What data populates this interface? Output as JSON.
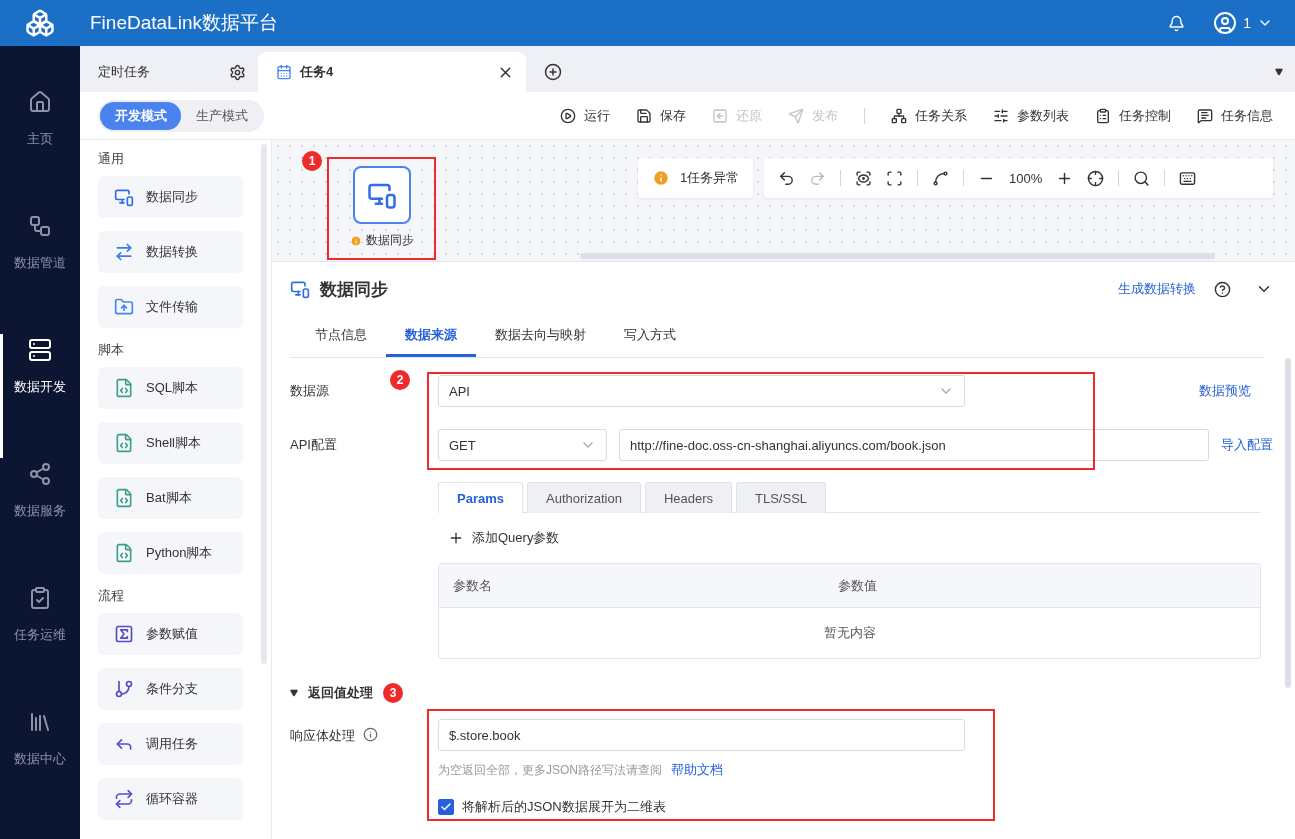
{
  "app": {
    "title": "FineDataLink数据平台",
    "user": "1"
  },
  "nav": [
    {
      "label": "主页",
      "selected": false
    },
    {
      "label": "数据管道",
      "selected": false
    },
    {
      "label": "数据开发",
      "selected": true
    },
    {
      "label": "数据服务",
      "selected": false
    },
    {
      "label": "任务运维",
      "selected": false
    },
    {
      "label": "数据中心",
      "selected": false
    }
  ],
  "tabs": [
    {
      "label": "定时任务",
      "kind": "folder",
      "selected": false
    },
    {
      "label": "任务4",
      "kind": "task",
      "selected": true
    }
  ],
  "modes": [
    {
      "label": "开发模式",
      "selected": true
    },
    {
      "label": "生产模式",
      "selected": false
    }
  ],
  "toolbar": [
    {
      "label": "运行",
      "disabled": false
    },
    {
      "label": "保存",
      "disabled": false
    },
    {
      "label": "还原",
      "disabled": true
    },
    {
      "label": "发布",
      "disabled": true
    },
    {
      "label": "任务关系",
      "disabled": false
    },
    {
      "label": "参数列表",
      "disabled": false
    },
    {
      "label": "任务控制",
      "disabled": false
    },
    {
      "label": "任务信息",
      "disabled": false
    }
  ],
  "palette": [
    {
      "title": "通用",
      "items": [
        "数据同步",
        "数据转换",
        "文件传输"
      ]
    },
    {
      "title": "脚本",
      "items": [
        "SQL脚本",
        "Shell脚本",
        "Bat脚本",
        "Python脚本"
      ]
    },
    {
      "title": "流程",
      "items": [
        "参数赋值",
        "条件分支",
        "调用任务",
        "循环容器"
      ]
    }
  ],
  "canvas": {
    "warning": "1任务异常",
    "zoom": "100%",
    "node": {
      "label": "数据同步",
      "marker": "1",
      "warning": true
    }
  },
  "panel": {
    "title": "数据同步",
    "link": "生成数据转换",
    "expanded": true,
    "tabs": [
      {
        "label": "节点信息",
        "selected": false
      },
      {
        "label": "数据来源",
        "selected": true
      },
      {
        "label": "数据去向与映射",
        "selected": false
      },
      {
        "label": "写入方式",
        "selected": false
      }
    ],
    "marker": "2",
    "source": {
      "label": "数据源",
      "value": "API",
      "link": "数据预览"
    },
    "api": {
      "label": "API配置",
      "method": "GET",
      "url": "http://fine-doc.oss-cn-shanghai.aliyuncs.com/book.json",
      "link": "导入配置"
    },
    "request_tabs": [
      {
        "label": "Params",
        "selected": true
      },
      {
        "label": "Authorization",
        "selected": false
      },
      {
        "label": "Headers",
        "selected": false
      },
      {
        "label": "TLS/SSL",
        "selected": false
      }
    ],
    "add_label": "添加Query参数",
    "table": {
      "columns": [
        "参数名",
        "参数值"
      ],
      "empty": "暂无内容"
    },
    "response": {
      "title": "返回值处理",
      "expanded": true,
      "marker": "3",
      "label": "响应体处理",
      "value": "$.store.book",
      "hint": "为空返回全部，更多JSON路径写法请查阅",
      "help": "帮助文档",
      "checkbox": {
        "label": "将解析后的JSON数据展开为二维表",
        "checked": true
      }
    }
  }
}
